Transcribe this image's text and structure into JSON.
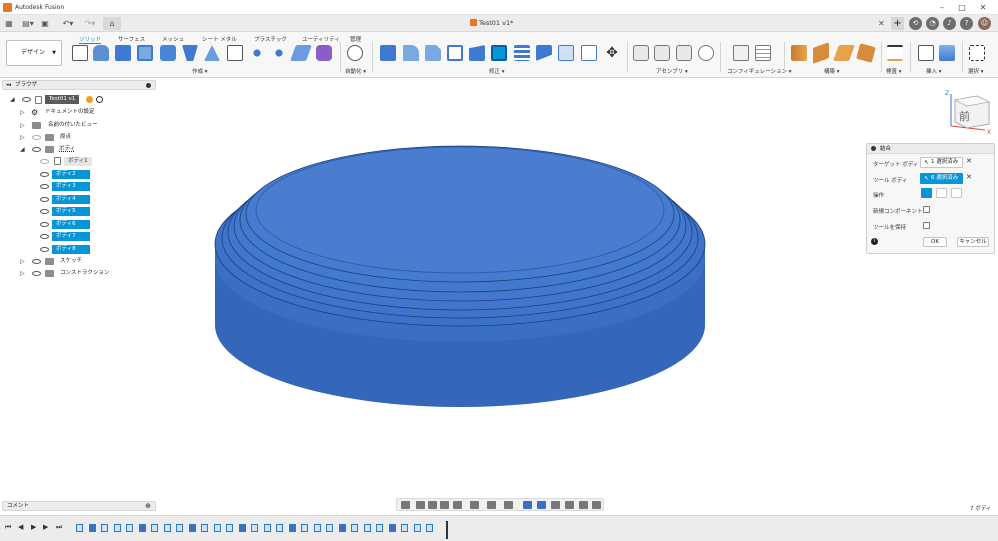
{
  "window": {
    "app_title": "Autodesk Fusion",
    "document_tab": "Test01 v1*"
  },
  "toolbar": {
    "workspace": "デザイン",
    "tabs": [
      "ソリッド",
      "サーフェス",
      "メッシュ",
      "シート メタル",
      "プラスチック",
      "ユーティリティ",
      "管理"
    ],
    "active_tab": "ソリッド",
    "groups": [
      "作成",
      "自動化",
      "修正",
      "アセンブリ",
      "コンフィギュレーション",
      "構築",
      "検査",
      "挿入",
      "選択"
    ]
  },
  "browser": {
    "title": "ブラウザ",
    "root": "Test01 v1",
    "items": [
      "ドキュメントの設定",
      "名前の付いたビュー",
      "原点",
      "ボディ"
    ],
    "bodies": [
      {
        "label": "ボディ1",
        "selected": false
      },
      {
        "label": "ボディ2",
        "selected": true
      },
      {
        "label": "ボディ3",
        "selected": true
      },
      {
        "label": "ボディ4",
        "selected": true
      },
      {
        "label": "ボディ5",
        "selected": true
      },
      {
        "label": "ボディ6",
        "selected": true
      },
      {
        "label": "ボディ7",
        "selected": true
      },
      {
        "label": "ボディ8",
        "selected": true
      }
    ],
    "after_items": [
      "スケッチ",
      "コンストラクション"
    ]
  },
  "combine": {
    "title": "結合",
    "target_label": "ターゲット ボディ",
    "target_value": "1 選択済み",
    "tool_label": "ツール ボディ",
    "tool_value": "6 選択済み",
    "operation_label": "操作",
    "new_component_label": "新規コンポーネント",
    "keep_tools_label": "ツールを保持",
    "ok": "OK",
    "cancel": "キャンセル"
  },
  "viewcube": {
    "face": "前"
  },
  "comments": {
    "label": "コメント"
  },
  "status": {
    "body_count": "7 ボディ"
  },
  "colors": {
    "accent": "#0696d7",
    "model": "#3b6fc4",
    "model_dark": "#2e5aa8",
    "model_top": "#4a7dd0"
  }
}
